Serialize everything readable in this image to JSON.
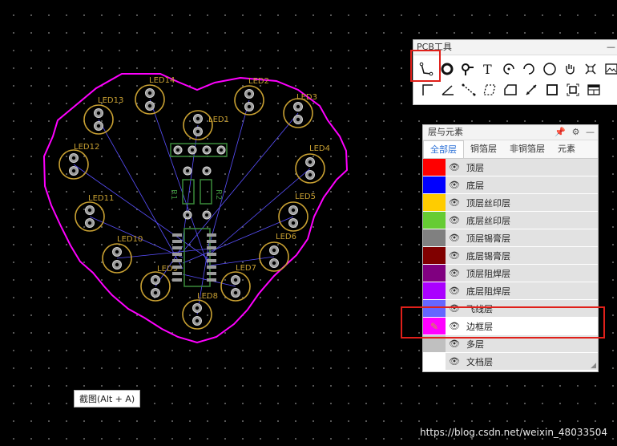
{
  "capture_tooltip": "截图(Alt + A)",
  "watermark": "https://blog.csdn.net/weixin_48033504",
  "leds": [
    "LED1",
    "LED2",
    "LED3",
    "LED4",
    "LED5",
    "LED6",
    "LED7",
    "LED8",
    "LED9",
    "LED10",
    "LED11",
    "LED12",
    "LED13",
    "LED14"
  ],
  "components": {
    "r1": "R1",
    "r2": "R2"
  },
  "pcb_tools": {
    "title": "PCB工具",
    "minimize": "—",
    "row1": [
      "wire-icon",
      "circle-pad-icon",
      "via-icon",
      "text-icon",
      "arc-icon",
      "arc2-icon",
      "circle-icon",
      "hand-icon",
      "canvas-origin-icon",
      "image-icon"
    ],
    "row2": [
      "corner-line-icon",
      "angle-icon",
      "dashed-line-icon",
      "rect-region-icon",
      "solid-region-icon",
      "dimension-icon",
      "square-icon",
      "connect-icon",
      "table-icon"
    ]
  },
  "layers_panel": {
    "title": "层与元素",
    "pin": "📌",
    "settings": "⚙",
    "minimize": "—",
    "tabs": [
      "全部层",
      "铜箔层",
      "非铜箔层",
      "元素"
    ],
    "layers": [
      {
        "name": "顶层",
        "color": "#ff0000"
      },
      {
        "name": "底层",
        "color": "#0000ff"
      },
      {
        "name": "顶层丝印层",
        "color": "#ffcc00"
      },
      {
        "name": "底层丝印层",
        "color": "#66cc33"
      },
      {
        "name": "顶层锡膏层",
        "color": "#808080"
      },
      {
        "name": "底层锡膏层",
        "color": "#800000"
      },
      {
        "name": "顶层阻焊层",
        "color": "#800080"
      },
      {
        "name": "底层阻焊层",
        "color": "#aa00ff"
      },
      {
        "name": "飞线层",
        "color": "#6666ff"
      },
      {
        "name": "边框层",
        "color": "#ff00ff"
      },
      {
        "name": "多层",
        "color": "#c0c0c0"
      },
      {
        "name": "文档层",
        "color": "#ffffff"
      }
    ]
  },
  "colors": {
    "board_outline": "#ff00ff",
    "silkscreen": "#c8a032",
    "ratsnest": "#5a50ff",
    "highlight": "#e0201a"
  }
}
